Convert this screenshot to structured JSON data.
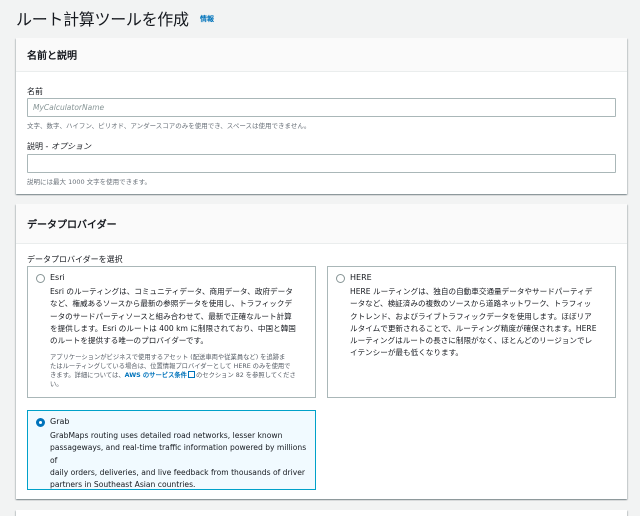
{
  "header": {
    "title": "ルート計算ツールを作成",
    "info": "情報"
  },
  "name_section": {
    "heading": "名前と説明",
    "name_label": "名前",
    "name_placeholder": "MyCalculatorName",
    "name_hint": "文字、数字、ハイフン、ピリオド、アンダースコアのみを使用でき、スペースは使用できません。",
    "desc_label": "説明 - ",
    "desc_optional": "オプション",
    "desc_hint": "説明には最大 1000 文字を使用できます。"
  },
  "provider_section": {
    "heading": "データプロバイダー",
    "select_label": "データプロバイダーを選択",
    "selected": "Grab",
    "esri": {
      "title": "Esri",
      "desc_lines": [
        "Esri のルーティングは、コミュニティデータ、商用データ、政府データ",
        "など、権威あるソースから最新の参照データを使用し、トラフィックデ",
        "ータのサードパーティソースと組み合わせて、最新で正確なルート計算",
        "を提供します。Esri のルートは 400 km に制限されており、中国と韓国",
        "のルートを提供する唯一のプロバイダーです。"
      ],
      "note_lines_1": "アプリケーションがビジネスで使用するアセット (配送車両や従業員など) を追跡ま",
      "note_lines_2": "たはルーティングしている場合は、位置情報プロバイダーとして HERE のみを使用で",
      "note_pre": "きます。詳細については、",
      "note_link": "AWS のサービス条件",
      "note_post": "のセクション 82 を参照してくださ",
      "note_end": "い。"
    },
    "here": {
      "title": "HERE",
      "desc_lines": [
        "HERE ルーティングは、独自の自動車交通量データやサードパーティデ",
        "ータなど、検証済みの複数のソースから道路ネットワーク、トラフィッ",
        "クトレンド、およびライブトラフィックデータを使用します。ほぼリア",
        "ルタイムで更新されることで、ルーティング精度が確保されます。HERE",
        "ルーティングはルートの長さに制限がなく、ほとんどのリージョンでレ",
        "イテンシーが最も低くなります。"
      ]
    },
    "grab": {
      "title": "Grab",
      "desc_lines": [
        "GrabMaps routing uses detailed road networks, lesser known",
        "passageways, and real-time traffic information powered by millions of",
        "daily orders, deliveries, and live feedback from thousands of driver",
        "partners in Southeast Asian countries."
      ]
    }
  }
}
